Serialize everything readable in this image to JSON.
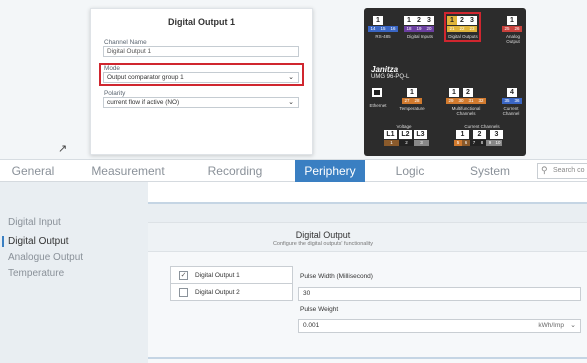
{
  "config": {
    "title": "Digital Output 1",
    "channel_name_label": "Channel Name",
    "channel_name_value": "Digital Output 1",
    "mode_label": "Mode",
    "mode_value": "Output comparator group 1",
    "polarity_label": "Polarity",
    "polarity_value": "current flow if active (NO)"
  },
  "device": {
    "brand": "Janitza",
    "model": "UMG 96-PQ-L",
    "top_terminals": [
      {
        "nums": [
          "1"
        ],
        "sub": [
          "14",
          "15",
          "16"
        ],
        "label": "RS-485"
      },
      {
        "nums": [
          "1",
          "2",
          "3"
        ],
        "sub": [
          "18",
          "19",
          "20"
        ],
        "label": "Digital Inputs"
      },
      {
        "nums": [
          "1",
          "2",
          "3"
        ],
        "sub": [
          "21",
          "22",
          "23"
        ],
        "label": "Digital Outputs"
      },
      {
        "nums": [
          "1"
        ],
        "sub": [
          "25",
          "26"
        ],
        "label": "Analog Output"
      }
    ],
    "mid_terminals": [
      {
        "nums": [
          ""
        ],
        "sub": [],
        "label": "Ethernet"
      },
      {
        "nums": [
          "1"
        ],
        "sub": [
          "27",
          "28"
        ],
        "label": "Temperature"
      },
      {
        "nums": [
          "1",
          "2"
        ],
        "sub": [
          "29",
          "30",
          "31",
          "32"
        ],
        "label": "Multifunctional Channels"
      },
      {
        "nums": [
          "4"
        ],
        "sub": [
          "35",
          "36"
        ],
        "label": "Current Channel"
      }
    ],
    "voltage_label": "Voltage",
    "voltage_terminals": [
      "L1",
      "L2",
      "L3"
    ],
    "voltage_sub": [
      "1",
      "2",
      "3"
    ],
    "current_label": "Current Channels",
    "current_terminals": [
      "1",
      "2",
      "3"
    ],
    "current_sub": [
      "5",
      "6",
      "7",
      "8",
      "9",
      "10"
    ]
  },
  "tabs": [
    "General",
    "Measurement",
    "Recording",
    "Periphery",
    "Logic",
    "System"
  ],
  "active_tab": "Periphery",
  "search_placeholder": "Search co",
  "sidebar": [
    "Digital Input",
    "Digital Output",
    "Analogue Output",
    "Temperature"
  ],
  "active_sidebar": "Digital Output",
  "section": {
    "title": "Digital Output",
    "subtitle": "Configure the digital outputs' functionality"
  },
  "outputs": [
    {
      "label": "Digital Output 1",
      "checked": true
    },
    {
      "label": "Digital Output 2",
      "checked": false
    }
  ],
  "pulse_width_label": "Pulse Width (Millisecond)",
  "pulse_width_value": "30",
  "pulse_weight_label": "Pulse Weight",
  "pulse_weight_value": "0.001",
  "pulse_weight_unit": "kWh/Imp",
  "colors": {
    "accent": "#3a7fc2",
    "highlight": "#d0262f",
    "terminal_yellow": "#e0b53b",
    "terminal_purple": "#6b3fa0",
    "terminal_blue": "#3a66c4",
    "terminal_red": "#c8413c",
    "terminal_orange": "#d17a2e",
    "terminal_brown": "#8a5a2b"
  }
}
